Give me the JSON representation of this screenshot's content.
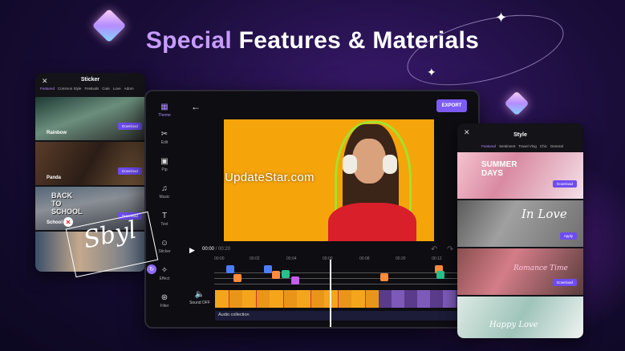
{
  "headline": {
    "accent": "Special",
    "rest": " Features & Materials"
  },
  "sticker_panel": {
    "title": "Sticker",
    "close": "✕",
    "tabs": [
      "Featured",
      "Common Style",
      "Festivals",
      "Cute",
      "Love",
      "Adorn"
    ],
    "tiles": [
      {
        "label": "Rainbow",
        "button": "Download"
      },
      {
        "label": "Panda",
        "button": "Download"
      },
      {
        "art_text": "BACK\nTO\nSCHOOL",
        "label": "School Day",
        "button": "Download"
      },
      {
        "label": ""
      }
    ]
  },
  "editor": {
    "export_label": "EXPORT",
    "sidebar": [
      {
        "icon": "theme-icon",
        "glyph": "▦",
        "label": "Theme",
        "active": true
      },
      {
        "icon": "scissors-icon",
        "glyph": "✂",
        "label": "Edit"
      },
      {
        "icon": "pip-icon",
        "glyph": "▣",
        "label": "Pip"
      },
      {
        "icon": "music-icon",
        "glyph": "♫",
        "label": "Music"
      },
      {
        "icon": "text-icon",
        "glyph": "T",
        "label": "Text"
      },
      {
        "icon": "sticker-icon",
        "glyph": "☺",
        "label": "Sticker"
      },
      {
        "icon": "effect-icon",
        "glyph": "✧",
        "label": "Effect"
      },
      {
        "icon": "filter-icon",
        "glyph": "⊛",
        "label": "Filter"
      }
    ],
    "sticker_text": "Sbyl",
    "watermark": "UpdateStar.com",
    "time_current": "00:00",
    "time_total": " / 00:20",
    "ruler": [
      "00:00",
      "00:02",
      "00:04",
      "00:00",
      "00:08",
      "00:20",
      "00:12"
    ],
    "sound_label": "Sound OFF",
    "audio_label": "Audio collection"
  },
  "style_panel": {
    "title": "Style",
    "close": "✕",
    "tabs": [
      "Featured",
      "Sentiment",
      "Travel Vlog",
      "Chic",
      "General"
    ],
    "tiles": [
      {
        "art_text": "SUMMER\nDAYS",
        "button": "Download"
      },
      {
        "art_text": "In Love",
        "button": "Apply"
      },
      {
        "art_text": "Romance Time",
        "button": "Download"
      },
      {
        "art_text": "Happy Love"
      }
    ]
  }
}
